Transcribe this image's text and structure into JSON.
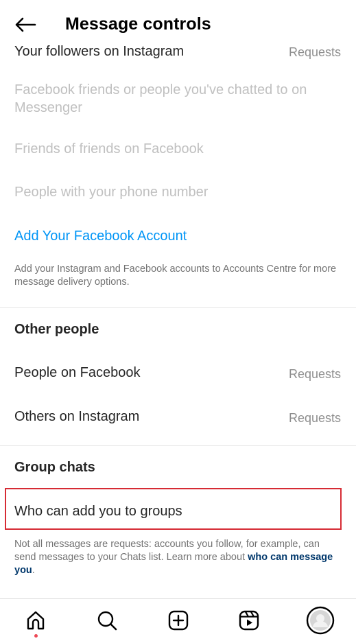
{
  "header": {
    "title": "Message controls"
  },
  "connected_accounts": {
    "rows": [
      {
        "label": "Your followers on Instagram",
        "value": "Requests"
      },
      {
        "label": "Facebook friends or people you've chatted to on Messenger"
      },
      {
        "label": "Friends of friends on Facebook"
      },
      {
        "label": "People with your phone number"
      }
    ],
    "add_account_link": "Add Your Facebook Account",
    "note": "Add your Instagram and Facebook accounts to Accounts Centre for more message delivery options."
  },
  "other_people": {
    "title": "Other people",
    "rows": [
      {
        "label": "People on Facebook",
        "value": "Requests"
      },
      {
        "label": "Others on Instagram",
        "value": "Requests"
      }
    ]
  },
  "group_chats": {
    "title": "Group chats",
    "rows": [
      {
        "label": "Who can add you to groups"
      }
    ]
  },
  "footer_note": {
    "text": "Not all messages are requests: accounts you follow, for example, can send messages to your Chats list. Learn more about ",
    "link": "who can message you",
    "end": "."
  },
  "tabbar": {
    "icons": [
      "home-icon",
      "search-icon",
      "create-icon",
      "reels-icon",
      "profile-avatar"
    ]
  },
  "colors": {
    "accent_link": "#0095f6",
    "highlight_border": "#d62b34",
    "notification_dot": "#ed4956"
  }
}
